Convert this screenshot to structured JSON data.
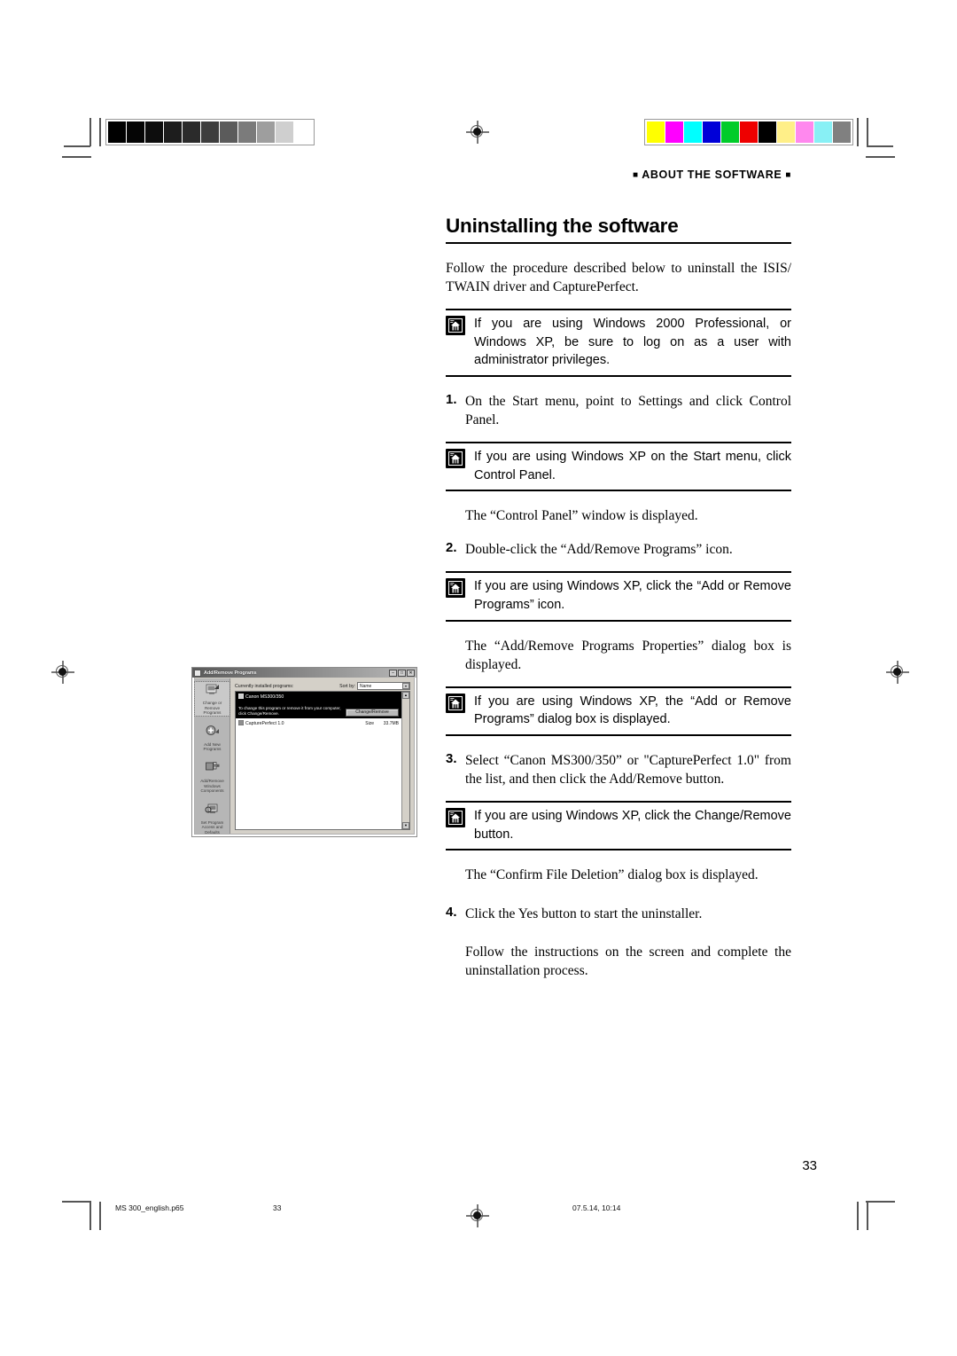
{
  "running_head": "ABOUT THE SOFTWARE",
  "title": "Uninstalling the software",
  "intro": "Follow the procedure described below to uninstall the ISIS/ TWAIN driver and CapturePerfect.",
  "notes": {
    "n1": "If you are using Windows 2000 Professional, or Windows XP, be sure to log on as a user with administrator privileges.",
    "n2": "If you are using Windows XP on the Start menu, click Control Panel.",
    "n3": "If you are using Windows XP, click the “Add or Remove Programs” icon.",
    "n4": "If you are using Windows XP, the “Add or Remove Programs” dialog box is displayed.",
    "n5": "If you are using Windows XP, click the Change/Remove button."
  },
  "steps": {
    "s1_num": "1.",
    "s1_text": "On the Start menu, point to Settings and click Control Panel.",
    "s1_result": "The “Control Panel” window is displayed.",
    "s2_num": "2.",
    "s2_text": "Double-click the “Add/Remove Programs” icon.",
    "s2_result": "The “Add/Remove Programs Properties” dialog box is displayed.",
    "s3_num": "3.",
    "s3_text": "Select “Canon MS300/350” or \"CapturePerfect 1.0\" from the list, and then click the Add/Remove button.",
    "s3_result": "The “Confirm File Deletion” dialog box is displayed.",
    "s4_num": "4.",
    "s4_text": "Click the Yes button to start the uninstaller.",
    "s4_result": "Follow the instructions on the screen and complete the uninstallation process."
  },
  "screenshot": {
    "window_title": "Add/Remove Programs",
    "min_label": "–",
    "max_label": "□",
    "close_label": "✕",
    "currently_installed_label": "Currently installed programs:",
    "sort_by_label": "Sort by:",
    "sort_by_value": "Name",
    "sidebar": [
      {
        "label": "Change or Remove Programs",
        "icon": "change-remove-programs-icon"
      },
      {
        "label": "Add New Programs",
        "icon": "add-new-programs-icon"
      },
      {
        "label": "Add/Remove Windows Components",
        "icon": "add-remove-windows-components-icon"
      },
      {
        "label": "Set Program Access and Defaults",
        "icon": "set-program-access-defaults-icon"
      }
    ],
    "selected_program": "Canon MS300/350",
    "selected_description": "To change this program or remove it from your computer, click Change/Remove.",
    "change_remove_button": "Change/Remove",
    "other_program": "CapturePerfect 1.0",
    "size_label": "Size",
    "size_value": "33.7MB",
    "scroll_up": "▲",
    "scroll_down": "▼",
    "combo_arrow": "▾"
  },
  "footer": {
    "page_number": "33",
    "file_name": "MS 300_english.p65",
    "file_page": "33",
    "timestamp": "07.5.14, 10:14"
  },
  "calibration": {
    "gray_steps": [
      "#000000",
      "#050505",
      "#0d0d0d",
      "#1d1d1d",
      "#2b2b2b",
      "#3d3d3d",
      "#5b5b5b",
      "#7b7b7b",
      "#9e9e9e",
      "#cfcfcf",
      "#ffffff"
    ],
    "color_steps": [
      "#ffff00",
      "#ff00ff",
      "#00ffff",
      "#0000d8",
      "#00cc2a",
      "#ee0000",
      "#000000",
      "#ffef88",
      "#ff88ee",
      "#88f0f5",
      "#808080"
    ]
  }
}
